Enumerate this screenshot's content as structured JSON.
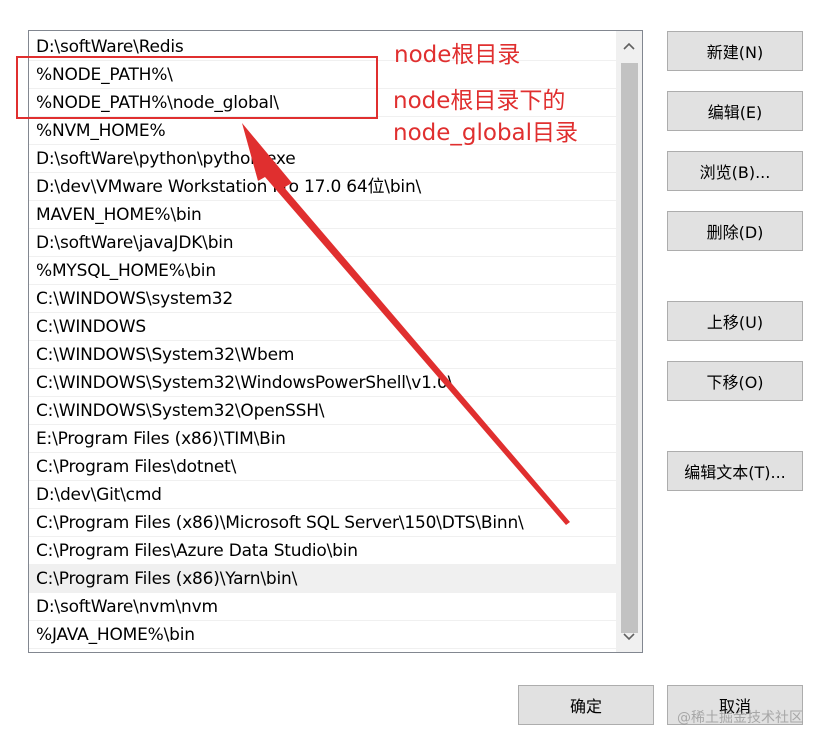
{
  "path_list": {
    "entries": [
      "D:\\softWare\\Redis",
      "%NODE_PATH%\\",
      "%NODE_PATH%\\node_global\\",
      "%NVM_HOME%",
      "D:\\softWare\\python\\python.exe",
      "D:\\dev\\VMware Workstation Pro 17.0 64位\\bin\\",
      "MAVEN_HOME%\\bin",
      "D:\\softWare\\javaJDK\\bin",
      "%MYSQL_HOME%\\bin",
      "C:\\WINDOWS\\system32",
      "C:\\WINDOWS",
      "C:\\WINDOWS\\System32\\Wbem",
      "C:\\WINDOWS\\System32\\WindowsPowerShell\\v1.0\\",
      "C:\\WINDOWS\\System32\\OpenSSH\\",
      "E:\\Program Files (x86)\\TIM\\Bin",
      "C:\\Program Files\\dotnet\\",
      "D:\\dev\\Git\\cmd",
      "C:\\Program Files (x86)\\Microsoft SQL Server\\150\\DTS\\Binn\\",
      "C:\\Program Files\\Azure Data Studio\\bin",
      "C:\\Program Files (x86)\\Yarn\\bin\\",
      "D:\\softWare\\nvm\\nvm",
      "%JAVA_HOME%\\bin"
    ],
    "selected_index": 19
  },
  "buttons": {
    "new": "新建(N)",
    "edit": "编辑(E)",
    "browse": "浏览(B)...",
    "delete": "删除(D)",
    "move_up": "上移(U)",
    "move_down": "下移(O)",
    "edit_text": "编辑文本(T)...",
    "ok": "确定",
    "cancel": "取消"
  },
  "annotations": {
    "color": "#e02f2f",
    "label_1": "node根目录",
    "label_2_line_1": "node根目录下的",
    "label_2_line_2": "node_global目录"
  },
  "watermark": "@稀土掘金技术社区"
}
